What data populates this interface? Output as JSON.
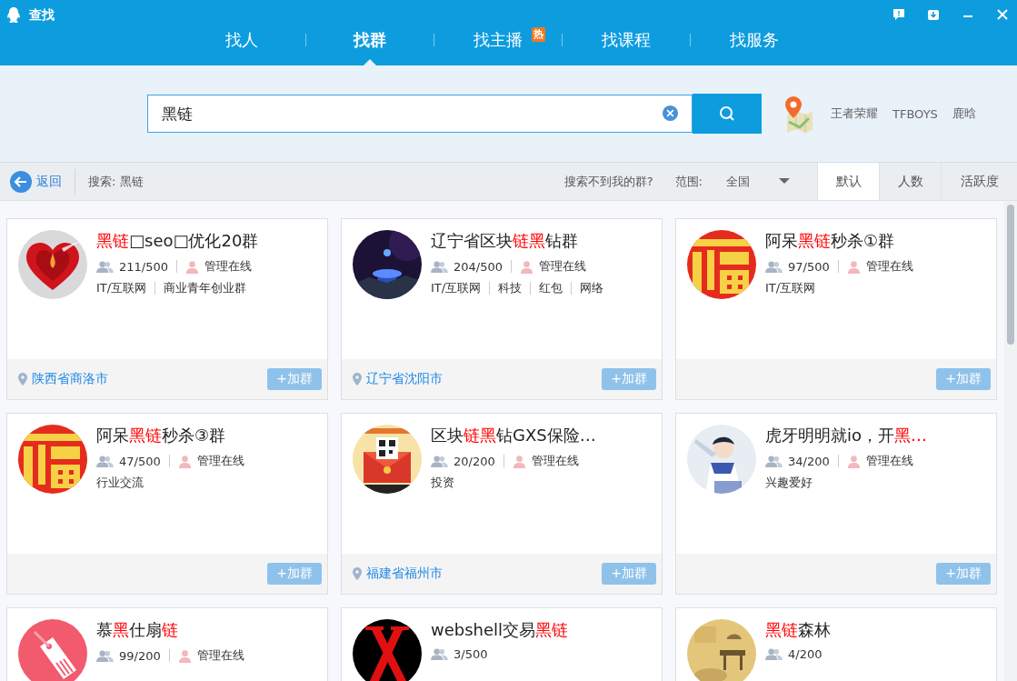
{
  "window": {
    "title": "查找"
  },
  "nav_tabs": [
    {
      "label": "找人",
      "selected": false
    },
    {
      "label": "找群",
      "selected": true
    },
    {
      "label": "找主播",
      "selected": false,
      "badge": "热"
    },
    {
      "label": "找课程",
      "selected": false
    },
    {
      "label": "找服务",
      "selected": false
    }
  ],
  "search": {
    "value": "黑链"
  },
  "hot_keywords": [
    "王者荣耀",
    "TFBOYS",
    "鹿晗"
  ],
  "toolbar": {
    "back": "返回",
    "query": "搜索: 黑链",
    "not_found_link": "搜索不到我的群?",
    "range_label": "范围:",
    "range_value": "全国",
    "sort_tabs": [
      {
        "label": "默认",
        "selected": true
      },
      {
        "label": "人数",
        "selected": false
      },
      {
        "label": "活跃度",
        "selected": false
      }
    ]
  },
  "groups": [
    {
      "kind": "picture",
      "title": [
        {
          "text": "黑链",
          "highlight": true
        },
        {
          "text": "□seo□优化20群",
          "highlight": false
        }
      ],
      "members": "211/500",
      "admin": "管理在线",
      "tags": [
        "IT/互联网",
        "商业青年创业群"
      ],
      "location": "陕西省商洛市",
      "join": "+加群"
    },
    {
      "kind": "picture",
      "title": [
        {
          "text": "辽宁省区块",
          "highlight": false
        },
        {
          "text": "链黑",
          "highlight": true
        },
        {
          "text": "钻群",
          "highlight": false
        }
      ],
      "members": "204/500",
      "admin": "管理在线",
      "tags": [
        "IT/互联网",
        "科技",
        "红包",
        "网络"
      ],
      "location": "辽宁省沈阳市",
      "join": "+加群"
    },
    {
      "kind": "picture",
      "title": [
        {
          "text": "阿呆",
          "highlight": false
        },
        {
          "text": "黑链",
          "highlight": true
        },
        {
          "text": "秒杀①群",
          "highlight": false
        }
      ],
      "members": "97/500",
      "admin": "管理在线",
      "tags": [
        "IT/互联网"
      ],
      "join": "+加群"
    },
    {
      "kind": "picture",
      "title": [
        {
          "text": "阿呆",
          "highlight": false
        },
        {
          "text": "黑链",
          "highlight": true
        },
        {
          "text": "秒杀③群",
          "highlight": false
        }
      ],
      "members": "47/500",
      "admin": "管理在线",
      "tags": [
        "行业交流"
      ],
      "join": "+加群"
    },
    {
      "kind": "picture",
      "title": [
        {
          "text": "区块",
          "highlight": false
        },
        {
          "text": "链黑",
          "highlight": true
        },
        {
          "text": "钻GXS保险…",
          "highlight": false
        }
      ],
      "members": "20/200",
      "admin": "管理在线",
      "tags": [
        "投资"
      ],
      "location": "福建省福州市",
      "join": "+加群"
    },
    {
      "kind": "picture",
      "title": [
        {
          "text": "虎牙明明就io，开",
          "highlight": false
        },
        {
          "text": "黑…",
          "highlight": true
        }
      ],
      "members": "34/200",
      "admin": "管理在线",
      "tags": [
        "兴趣爱好"
      ],
      "join": "+加群"
    },
    {
      "kind": "picture",
      "title": [
        {
          "text": "慕",
          "highlight": false
        },
        {
          "text": "黑",
          "highlight": true
        },
        {
          "text": "仕扇",
          "highlight": false
        },
        {
          "text": "链",
          "highlight": true
        }
      ],
      "members": "99/200",
      "admin": "管理在线"
    },
    {
      "kind": "picture",
      "title": [
        {
          "text": "webshell交易",
          "highlight": false
        },
        {
          "text": "黑链",
          "highlight": true
        }
      ],
      "members": "3/500"
    },
    {
      "kind": "picture",
      "title": [
        {
          "text": "黑链",
          "highlight": true
        },
        {
          "text": "森林",
          "highlight": false
        }
      ],
      "members": "4/200"
    }
  ]
}
